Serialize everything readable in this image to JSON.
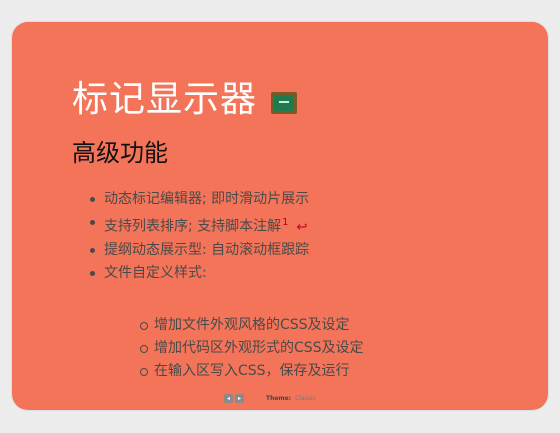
{
  "slide": {
    "title": "标记显示器",
    "subtitle": "高级功能",
    "bullets": {
      "item1": "动态标记编辑器; 即时滑动片展示",
      "item2": "支持列表排序; 支持脚本注解",
      "item2_footnote": "1",
      "item3": "提纲动态展示型: 自动滚动框跟踪",
      "item4": "文件自定义样式:"
    },
    "subbullets": {
      "item1": "增加文件外观风格的CSS及设定",
      "item2": "增加代码区外观形式的CSS及设定",
      "item3": "在输入区写入CSS，保存及运行"
    },
    "background_color": "#f37458",
    "title_color": "#ffffff",
    "footnote_color": "#c0001f"
  },
  "footer": {
    "prev_glyph": "◂",
    "next_glyph": "▸",
    "theme_label": "Theme:",
    "theme_value": "Classic"
  },
  "icons": {
    "title_icon": "chalkboard-icon",
    "footnote_return": "return-arrow-icon"
  }
}
